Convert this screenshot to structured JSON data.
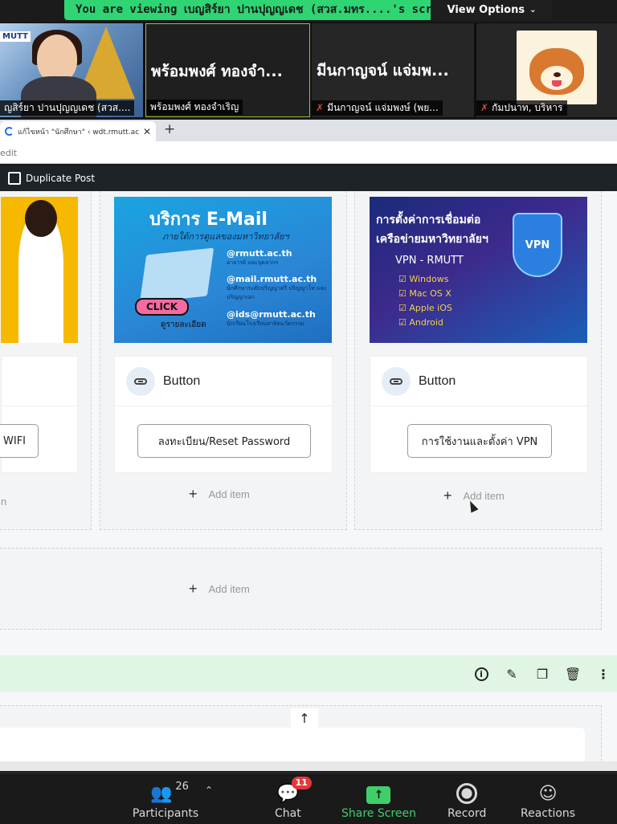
{
  "banner": {
    "text": "You are viewing เบญสิร์ยา ปานปุญญเดช (สวส.มทร....'s screen",
    "options_label": "View Options"
  },
  "participants": [
    {
      "name": "ญสิร์ยา ปานปุญญเดช (สวส....",
      "big_name": "",
      "muted": false,
      "logo_text": "MUTT"
    },
    {
      "name": "พร้อมพงศ์ ทองจำเริญ",
      "big_name": "พร้อมพงศ์ ทองจำ...",
      "muted": false
    },
    {
      "name": "มีนกาญจน์ แจ่มพงษ์ (พย...",
      "big_name": "มีนกาญจน์ แจ่มพ...",
      "muted": true
    },
    {
      "name": "กัมปนาท, บริหาร",
      "big_name": "",
      "muted": true
    }
  ],
  "browser": {
    "tab_title": "แก้ไขหน้า \"นักศึกษา\" ‹ wdt.rmutt.ac",
    "url_fragment": "edit"
  },
  "wp_toolbar": {
    "duplicate_label": "Duplicate Post"
  },
  "cards": [
    {
      "button_label": "WIFI"
    },
    {
      "img_title": "บริการ E-Mail",
      "img_subtitle": "ภายใต้การดูแลของมหาวิทยาลัยฯ",
      "img_items": [
        {
          "address": "@rmutt.ac.th",
          "desc": "อาจารย์ และบุคลากร"
        },
        {
          "address": "@mail.rmutt.ac.th",
          "desc": "นักศึกษาระดับปริญญาตรี ปริญญาโท และปริญญาเอก"
        },
        {
          "address": "@ids@rmutt.ac.th",
          "desc": "นักเรียนโรงเรียนสาธิตนวัตกรรม"
        }
      ],
      "img_click": "CLICK",
      "img_details": "ดูรายละเอียด",
      "panel_title": "Button",
      "button_label": "ลงทะเบียน/Reset Password"
    },
    {
      "img_title_1": "การตั้งค่าการเชื่อมต่อ",
      "img_title_2": "เครือข่ายมหาวิทยาลัยฯ",
      "img_heading": "VPN - RMUTT",
      "img_items": [
        "Windows",
        "Mac OS X",
        "Apple iOS",
        "Android"
      ],
      "img_badge": "VPN",
      "panel_title": "Button",
      "button_label": "การใช้งานและตั้งค่า VPN"
    }
  ],
  "add_item_label": "Add item",
  "add_item_left_fragment": "n",
  "zoom_toolbar": {
    "participants_label": "Participants",
    "participants_count": "26",
    "chat_label": "Chat",
    "chat_badge": "11",
    "share_label": "Share Screen",
    "record_label": "Record",
    "reactions_label": "Reactions"
  },
  "colors": {
    "banner_green": "#2fd573",
    "active_speaker_border": "#9cc33a",
    "section_green": "#e1f5e4",
    "share_green": "#3fcf6a",
    "badge_red": "#e5383b"
  }
}
